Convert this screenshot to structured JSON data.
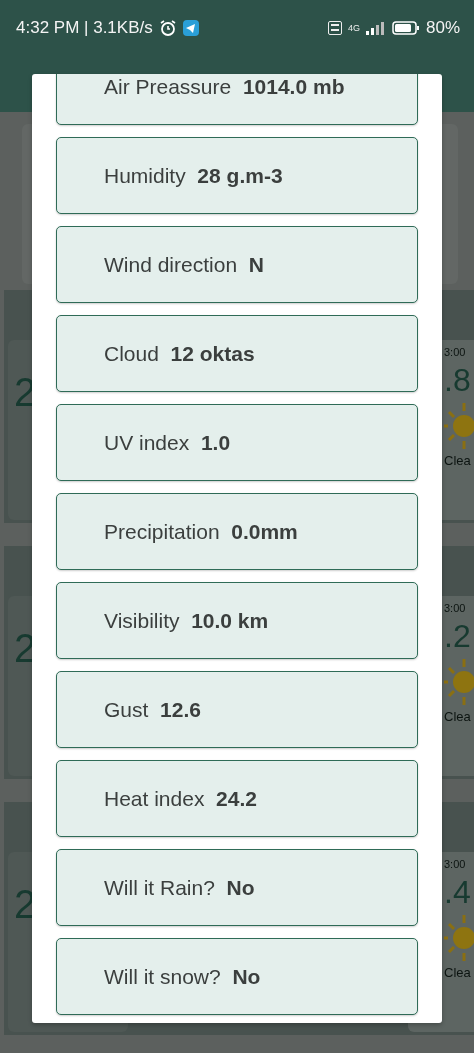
{
  "status_bar": {
    "time_speed": "4:32 PM | 3.1KB/s",
    "network": "4G",
    "battery": "80%"
  },
  "background_forecast": [
    {
      "temperature_partial": "2",
      "time_partial": "3:00",
      "value_partial": ".8",
      "condition_partial": "Clea"
    },
    {
      "temperature_partial": "2",
      "time_partial": "3:00",
      "value_partial": ".2",
      "condition_partial": "Clea"
    },
    {
      "temperature_partial": "2",
      "time_partial": "3:00",
      "value_partial": ".4",
      "condition_partial": "Clea"
    }
  ],
  "details_dialog": {
    "items": [
      {
        "label": "Air Preassure",
        "value": "1014.0 mb"
      },
      {
        "label": "Humidity",
        "value": "28 g.m-3"
      },
      {
        "label": "Wind direction",
        "value": "N"
      },
      {
        "label": "Cloud",
        "value": "12 oktas"
      },
      {
        "label": "UV index",
        "value": "1.0"
      },
      {
        "label": "Precipitation",
        "value": "0.0mm"
      },
      {
        "label": "Visibility",
        "value": "10.0 km"
      },
      {
        "label": "Gust",
        "value": "12.6"
      },
      {
        "label": "Heat index",
        "value": "24.2"
      },
      {
        "label": "Will it Rain?",
        "value": "No"
      },
      {
        "label": "Will it snow?",
        "value": "No"
      }
    ]
  }
}
